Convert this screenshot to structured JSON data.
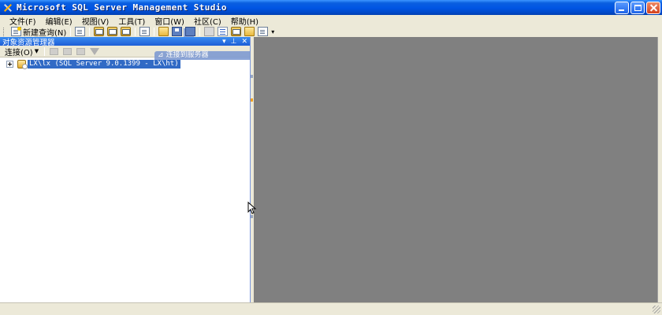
{
  "window": {
    "title": "Microsoft SQL Server Management Studio"
  },
  "menu": {
    "items": [
      {
        "label": "文件(F)"
      },
      {
        "label": "编辑(E)"
      },
      {
        "label": "视图(V)"
      },
      {
        "label": "工具(T)"
      },
      {
        "label": "窗口(W)"
      },
      {
        "label": "社区(C)"
      },
      {
        "label": "帮助(H)"
      }
    ]
  },
  "toolbar": {
    "new_query_label": "新建查询(N)",
    "icons": [
      "new-query-icon",
      "document-icon",
      "database-engine-query-icon",
      "analysis-query-icon",
      "mdx-query-icon",
      "template-icon",
      "open-file-icon",
      "save-icon",
      "save-all-icon",
      "registered-servers-icon",
      "object-explorer-icon",
      "template-explorer-icon",
      "properties-icon"
    ]
  },
  "object_explorer": {
    "title": "对象资源管理器",
    "connect_label": "连接(O)",
    "server_node": "LX\\lx (SQL Server 9.0.1399 - LX\\ht)"
  },
  "connect_hint": "连接到服务器",
  "colors": {
    "titlebar": "#0054e3",
    "panel_header": "#1d5ed6",
    "selection": "#316ac5",
    "workspace": "#808080"
  }
}
